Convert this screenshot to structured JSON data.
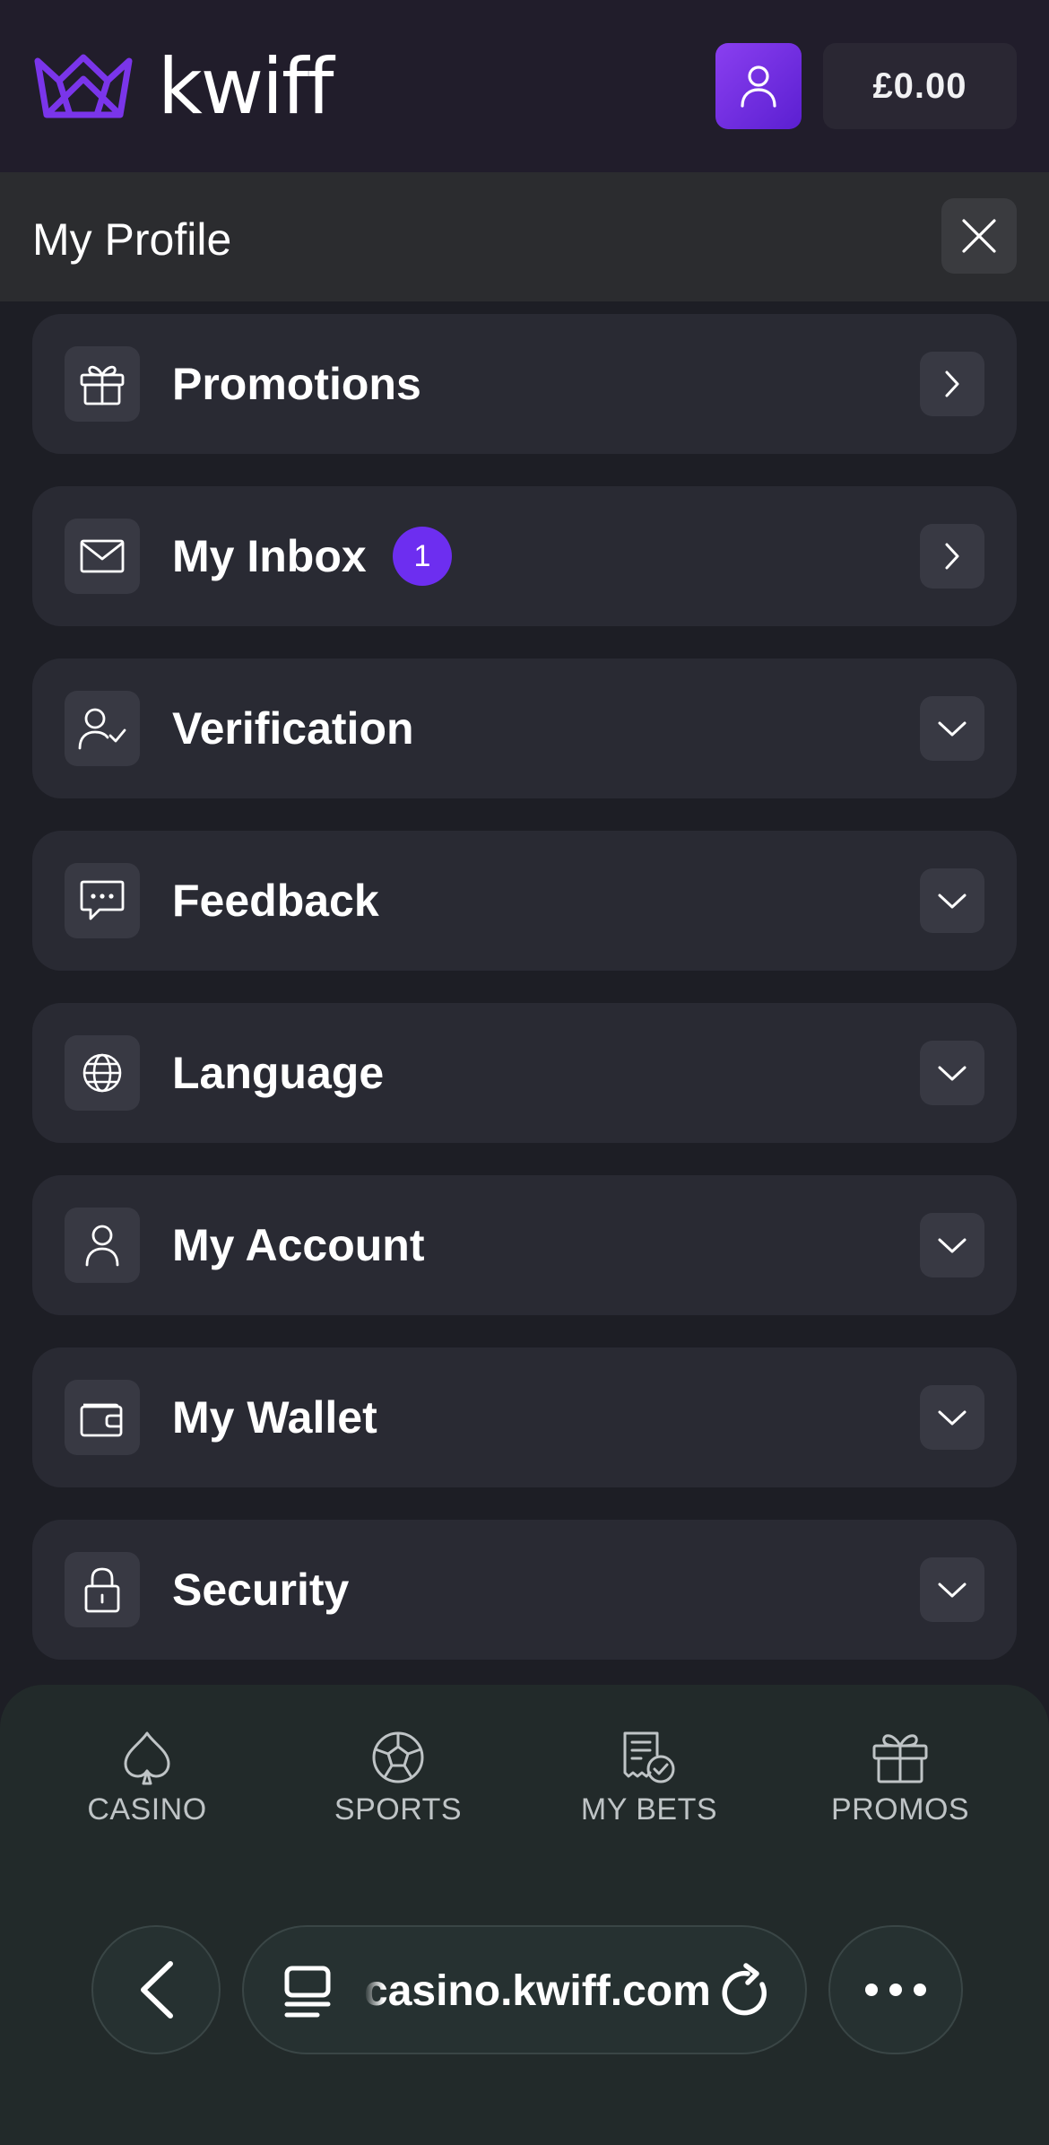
{
  "header": {
    "logo_text": "kwiff",
    "balance": "£0.00",
    "accent_color": "#7a35ea"
  },
  "titlebar": {
    "title": "My Profile"
  },
  "menu": {
    "items": [
      {
        "label": "Promotions",
        "icon": "gift-icon",
        "control": "chevron-right"
      },
      {
        "label": "My Inbox",
        "icon": "mail-icon",
        "control": "chevron-right",
        "badge": "1"
      },
      {
        "label": "Verification",
        "icon": "user-check-icon",
        "control": "chevron-down"
      },
      {
        "label": "Feedback",
        "icon": "chat-bubble-icon",
        "control": "chevron-down"
      },
      {
        "label": "Language",
        "icon": "globe-icon",
        "control": "chevron-down"
      },
      {
        "label": "My Account",
        "icon": "user-icon",
        "control": "chevron-down"
      },
      {
        "label": "My Wallet",
        "icon": "wallet-icon",
        "control": "chevron-down"
      },
      {
        "label": "Security",
        "icon": "lock-icon",
        "control": "chevron-down"
      }
    ]
  },
  "bottom_nav": {
    "items": [
      {
        "label": "CASINO",
        "icon": "spade-icon"
      },
      {
        "label": "SPORTS",
        "icon": "football-icon"
      },
      {
        "label": "MY BETS",
        "icon": "betslip-icon"
      },
      {
        "label": "PROMOS",
        "icon": "gift-icon"
      }
    ]
  },
  "browser": {
    "url": "casino.kwiff.com"
  }
}
